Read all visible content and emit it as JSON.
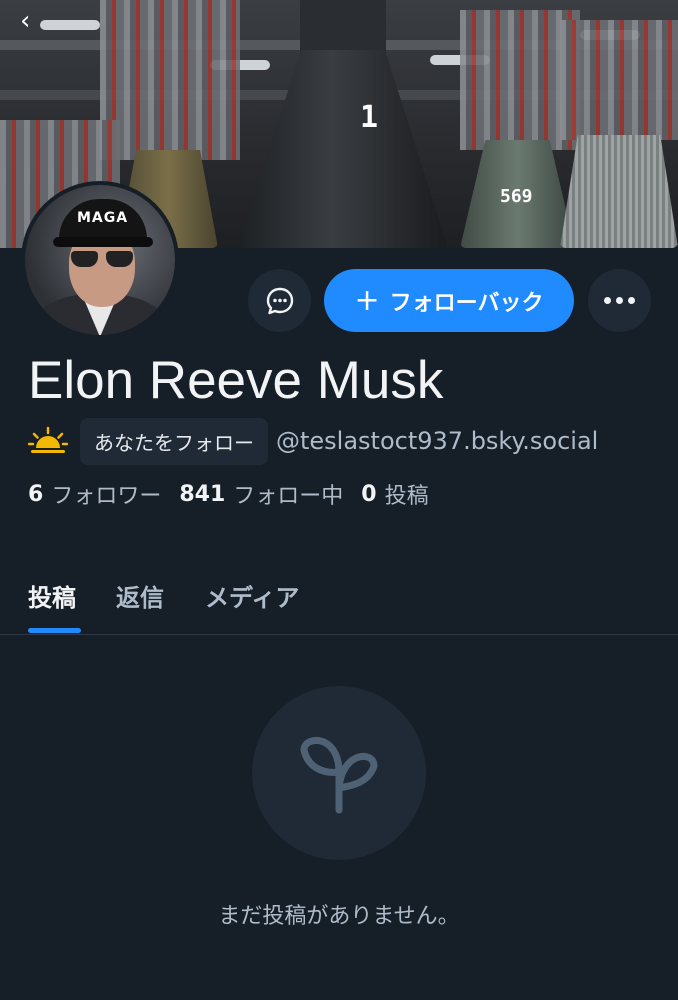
{
  "profile": {
    "banner_labels": [
      "1",
      "569"
    ],
    "avatar_cap_text": "MAGA",
    "display_name": "Elon Reeve Musk",
    "follows_you_label": "あなたをフォロー",
    "handle": "@teslastoct937.bsky.social"
  },
  "actions": {
    "follow_back_label": "フォローバック",
    "follow_back_icon": "plus-icon",
    "message_icon": "chat-bubble-icon",
    "more_icon": "ellipsis-icon"
  },
  "stats": {
    "followers_count": "6",
    "followers_label": "フォロワー",
    "following_count": "841",
    "following_label": "フォロー中",
    "posts_count": "0",
    "posts_label": "投稿"
  },
  "tabs": [
    {
      "label": "投稿",
      "active": true
    },
    {
      "label": "返信",
      "active": false
    },
    {
      "label": "メディア",
      "active": false
    }
  ],
  "empty_state": {
    "icon": "sprout-icon",
    "message": "まだ投稿がありません。"
  },
  "colors": {
    "background": "#161e27",
    "accent": "#208bfe",
    "surface": "#1f2a36",
    "muted_text": "#aebbc9"
  }
}
